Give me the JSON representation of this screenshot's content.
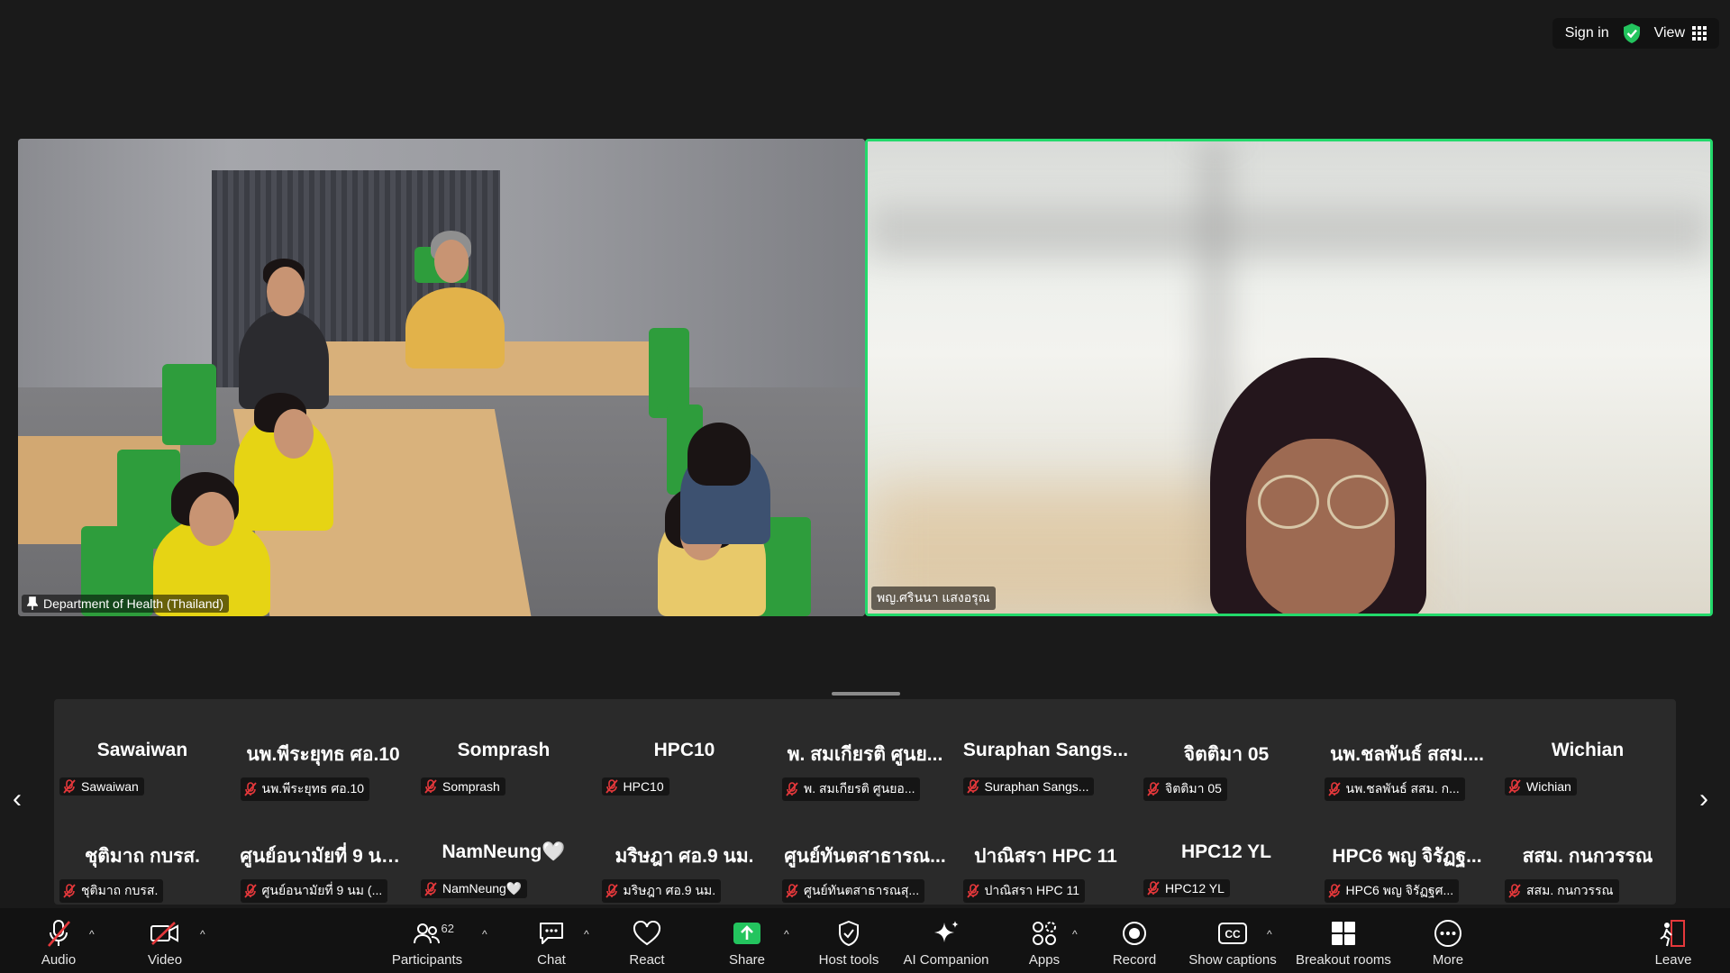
{
  "header": {
    "sign_in": "Sign in",
    "view": "View"
  },
  "tiles": {
    "left_name": "Department of Health (Thailand)",
    "right_name": "พญ.ศรินนา แสงอรุณ"
  },
  "participants": [
    {
      "big": "Sawaiwan",
      "small": "Sawaiwan"
    },
    {
      "big": "นพ.พีระยุทธ ศอ.10",
      "small": "นพ.พีระยุทธ ศอ.10"
    },
    {
      "big": "Somprash",
      "small": "Somprash"
    },
    {
      "big": "HPC10",
      "small": "HPC10"
    },
    {
      "big": "พ. สมเกียรติ ศูนย...",
      "small": "พ. สมเกียรติ ศูนยอ..."
    },
    {
      "big": "Suraphan Sangs...",
      "small": "Suraphan Sangs..."
    },
    {
      "big": "จิตติมา 05",
      "small": "จิตติมา 05"
    },
    {
      "big": "นพ.ชลพันธ์ สสม....",
      "small": "นพ.ชลพันธ์ สสม. ก..."
    },
    {
      "big": "Wichian",
      "small": "Wichian"
    },
    {
      "big": "ชุติมาถ กบรส.",
      "small": "ชุติมาถ กบรส."
    },
    {
      "big": "ศูนย์อนามัยที่ 9 นม...",
      "small": "ศูนย์อนามัยที่ 9 นม (..."
    },
    {
      "big": "NamNeung🤍",
      "small": "NamNeung🤍"
    },
    {
      "big": "มริษฎา ศอ.9 นม.",
      "small": "มริษฎา ศอ.9 นม."
    },
    {
      "big": "ศูนย์ทันตสาธารณ...",
      "small": "ศูนย์ทันตสาธารณสุ..."
    },
    {
      "big": "ปาณิสรา HPC 11",
      "small": "ปาณิสรา HPC 11"
    },
    {
      "big": "HPC12 YL",
      "small": "HPC12 YL"
    },
    {
      "big": "HPC6 พญ จิรัฏฐ...",
      "small": "HPC6 พญ จิรัฏฐศ..."
    },
    {
      "big": "สสม. กนกวรรณ",
      "small": "สสม. กนกวรรณ"
    }
  ],
  "toolbar": {
    "audio": "Audio",
    "video": "Video",
    "participants": "Participants",
    "participants_count": "62",
    "chat": "Chat",
    "react": "React",
    "share": "Share",
    "host_tools": "Host tools",
    "ai_companion": "AI Companion",
    "apps": "Apps",
    "record": "Record",
    "show_captions": "Show captions",
    "breakout_rooms": "Breakout rooms",
    "more": "More",
    "leave": "Leave"
  },
  "colors": {
    "active_speaker_border": "#23d96b",
    "share_green": "#23c45e",
    "mute_red": "#e5383b"
  }
}
